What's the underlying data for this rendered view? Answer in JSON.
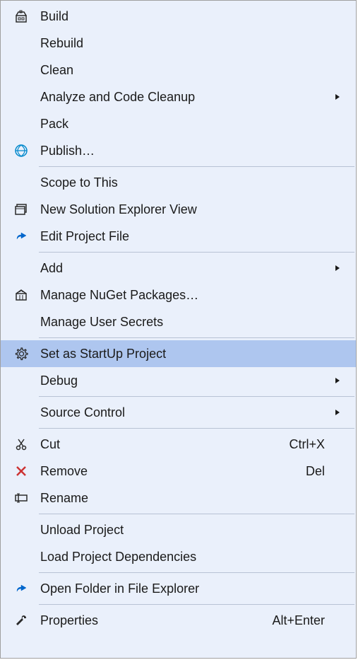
{
  "menu": {
    "items": [
      {
        "icon": "build-icon",
        "label": "Build",
        "submenu": false
      },
      {
        "icon": null,
        "label": "Rebuild",
        "submenu": false
      },
      {
        "icon": null,
        "label": "Clean",
        "submenu": false
      },
      {
        "icon": null,
        "label": "Analyze and Code Cleanup",
        "submenu": true
      },
      {
        "icon": null,
        "label": "Pack",
        "submenu": false
      },
      {
        "icon": "publish-icon",
        "label": "Publish…",
        "submenu": false
      },
      {
        "separator": true
      },
      {
        "icon": null,
        "label": "Scope to This",
        "submenu": false
      },
      {
        "icon": "new-view-icon",
        "label": "New Solution Explorer View",
        "submenu": false
      },
      {
        "icon": "edit-icon",
        "label": "Edit Project File",
        "submenu": false
      },
      {
        "separator": true
      },
      {
        "icon": null,
        "label": "Add",
        "submenu": true
      },
      {
        "icon": "nuget-icon",
        "label": "Manage NuGet Packages…",
        "submenu": false
      },
      {
        "icon": null,
        "label": "Manage User Secrets",
        "submenu": false
      },
      {
        "separator": true
      },
      {
        "icon": "gear-icon",
        "label": "Set as StartUp Project",
        "submenu": false,
        "hovered": true
      },
      {
        "icon": null,
        "label": "Debug",
        "submenu": true
      },
      {
        "separator": true
      },
      {
        "icon": null,
        "label": "Source Control",
        "submenu": true
      },
      {
        "separator": true
      },
      {
        "icon": "cut-icon",
        "label": "Cut",
        "shortcut": "Ctrl+X",
        "submenu": false
      },
      {
        "icon": "remove-icon",
        "label": "Remove",
        "shortcut": "Del",
        "submenu": false
      },
      {
        "icon": "rename-icon",
        "label": "Rename",
        "submenu": false
      },
      {
        "separator": true
      },
      {
        "icon": null,
        "label": "Unload Project",
        "submenu": false
      },
      {
        "icon": null,
        "label": "Load Project Dependencies",
        "submenu": false
      },
      {
        "separator": true
      },
      {
        "icon": "open-folder-icon",
        "label": "Open Folder in File Explorer",
        "submenu": false
      },
      {
        "separator": true
      },
      {
        "icon": "wrench-icon",
        "label": "Properties",
        "shortcut": "Alt+Enter",
        "submenu": false
      }
    ]
  }
}
